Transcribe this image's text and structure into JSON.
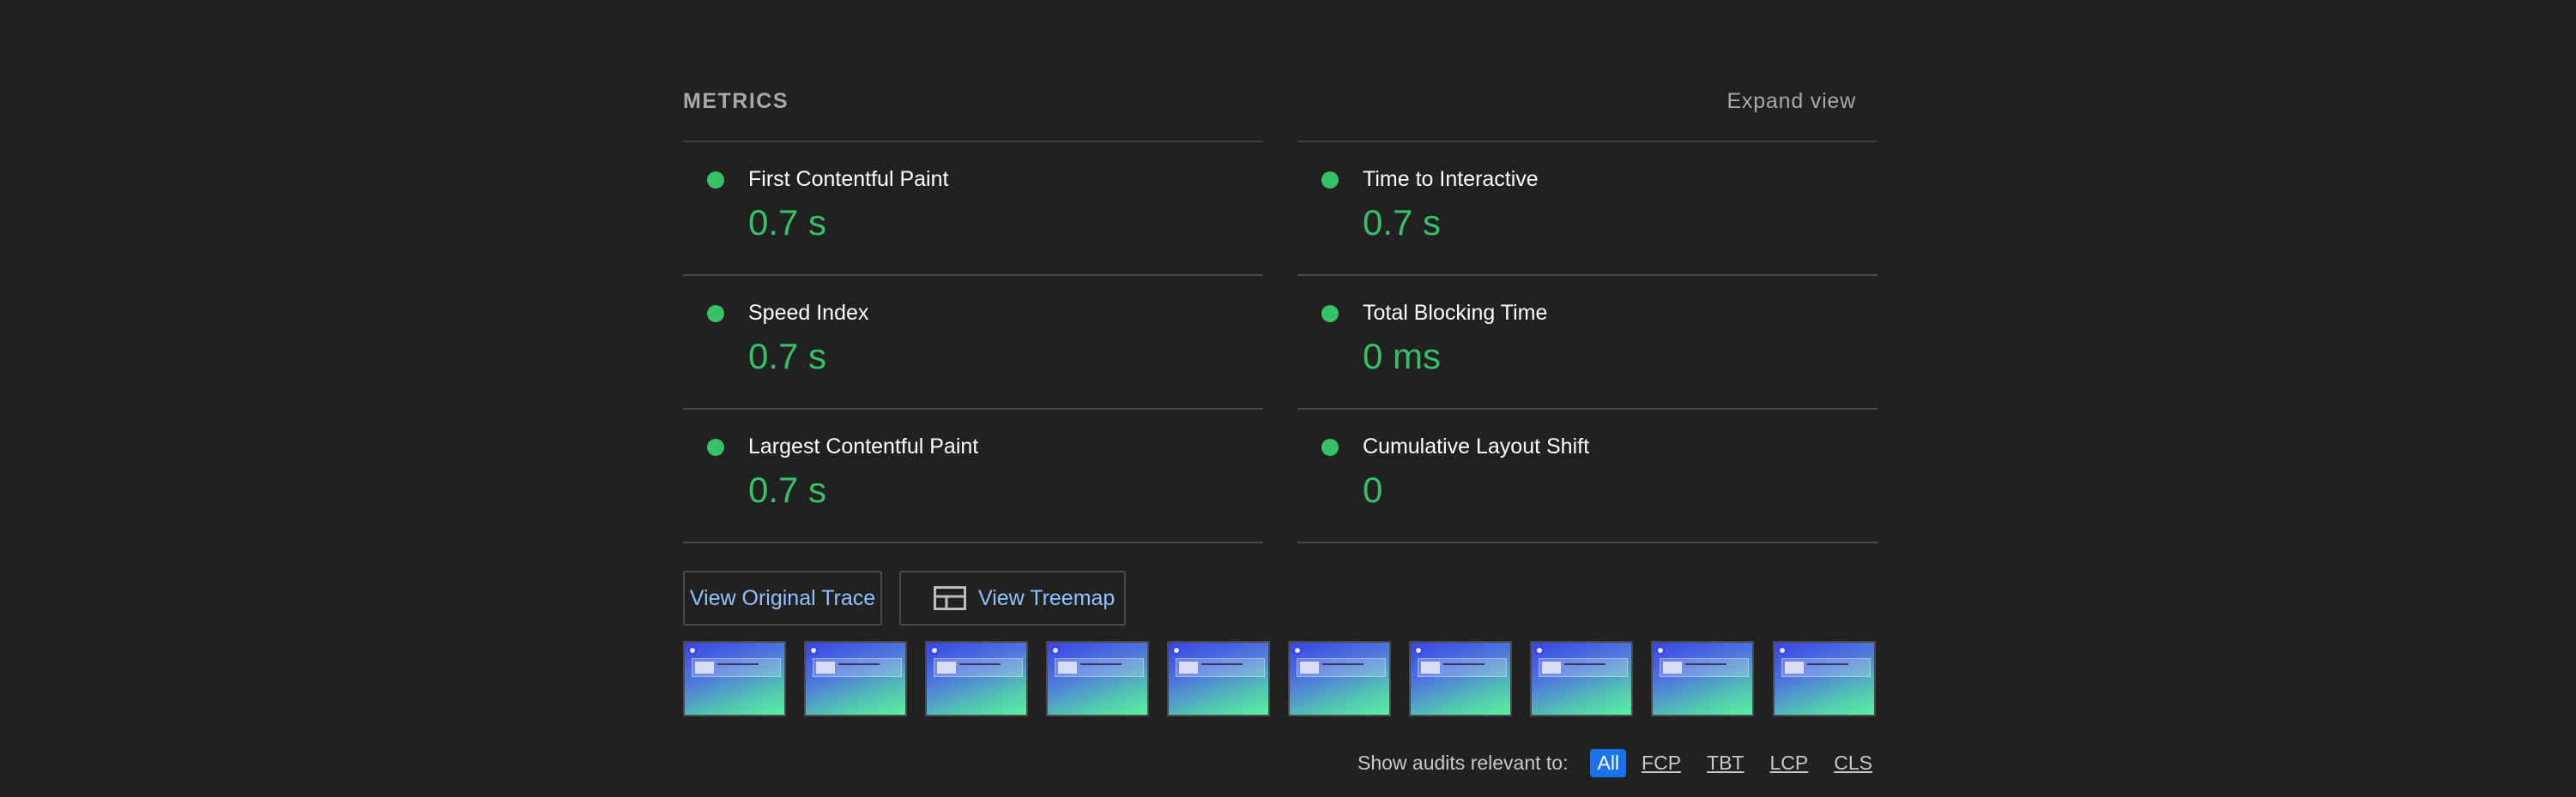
{
  "metrics": {
    "title": "METRICS",
    "expand_label": "Expand view",
    "items": [
      {
        "label": "First Contentful Paint",
        "value": "0.7 s"
      },
      {
        "label": "Time to Interactive",
        "value": "0.7 s"
      },
      {
        "label": "Speed Index",
        "value": "0.7 s"
      },
      {
        "label": "Total Blocking Time",
        "value": "0 ms"
      },
      {
        "label": "Largest Contentful Paint",
        "value": "0.7 s"
      },
      {
        "label": "Cumulative Layout Shift",
        "value": "0"
      }
    ],
    "status_color": "#36c166"
  },
  "buttons": {
    "trace_label": "View Original Trace",
    "treemap_label": "View Treemap",
    "treemap_icon": "treemap-icon"
  },
  "filmstrip": {
    "frame_count": 10
  },
  "filter": {
    "label": "Show audits relevant to:",
    "chips": [
      "All",
      "FCP",
      "TBT",
      "LCP",
      "CLS"
    ],
    "active": "All",
    "active_color": "#1a73e8"
  }
}
